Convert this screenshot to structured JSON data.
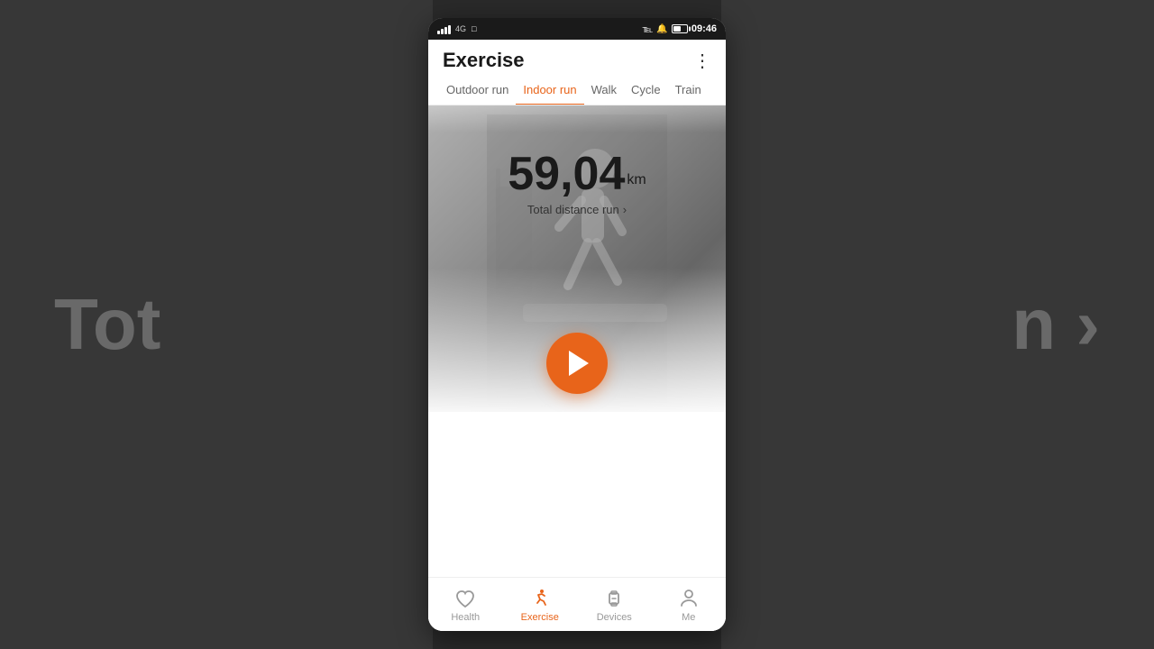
{
  "background": {
    "left_text": "Tot",
    "right_text": "n ›"
  },
  "status_bar": {
    "time": "09:46",
    "battery_level": "62"
  },
  "header": {
    "title": "Exercise",
    "more_label": "⋮"
  },
  "tabs": [
    {
      "id": "outdoor-run",
      "label": "Outdoor run",
      "active": false
    },
    {
      "id": "indoor-run",
      "label": "Indoor run",
      "active": true
    },
    {
      "id": "walk",
      "label": "Walk",
      "active": false
    },
    {
      "id": "cycle",
      "label": "Cycle",
      "active": false
    },
    {
      "id": "train",
      "label": "Train",
      "active": false
    }
  ],
  "hero": {
    "distance_value": "59,04",
    "distance_unit": "km",
    "distance_label": "Total distance run",
    "chevron": "›"
  },
  "play_button": {
    "aria_label": "Start workout"
  },
  "bottom_nav": [
    {
      "id": "health",
      "label": "Health",
      "active": false,
      "icon": "heart-icon"
    },
    {
      "id": "exercise",
      "label": "Exercise",
      "active": true,
      "icon": "run-icon"
    },
    {
      "id": "devices",
      "label": "Devices",
      "active": false,
      "icon": "devices-icon"
    },
    {
      "id": "me",
      "label": "Me",
      "active": false,
      "icon": "me-icon"
    }
  ]
}
